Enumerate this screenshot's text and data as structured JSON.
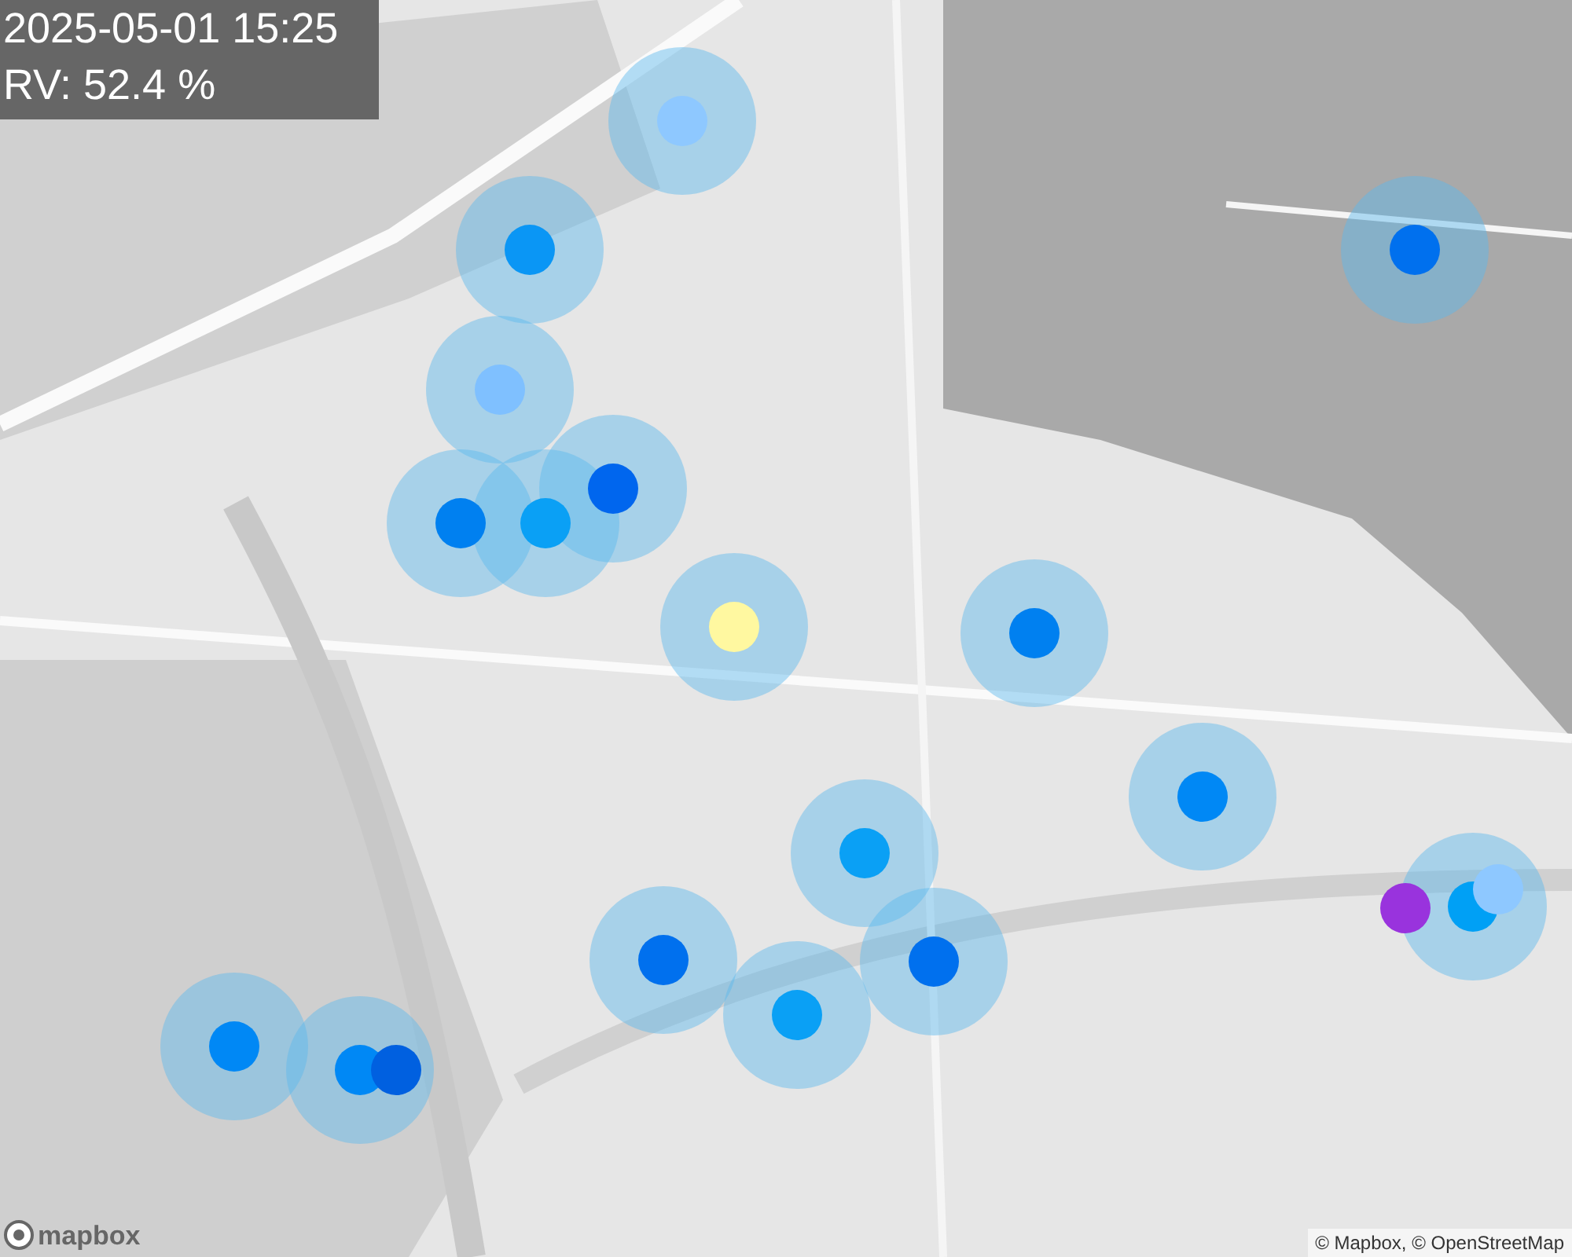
{
  "overlay": {
    "timestamp": "2025-05-01 15:25",
    "humidity": "RV: 52.4 %"
  },
  "markers": [
    {
      "color": "#8ec8ff"
    },
    {
      "color": "#0a96f5"
    },
    {
      "color": "#7fc0ff"
    },
    {
      "color": "#0066ee"
    },
    {
      "color": "#0080f0"
    },
    {
      "color": "#0aa0f5"
    },
    {
      "color": "#fff8a0"
    },
    {
      "color": "#0080f0"
    },
    {
      "color": "#0070ee"
    },
    {
      "color": "#0088f5"
    },
    {
      "color": "#0aa0f5"
    },
    {
      "color": "#0070ee"
    },
    {
      "color": "#0aa0f5"
    },
    {
      "color": "#0070ee"
    },
    {
      "color": "#0088f5"
    },
    {
      "color": "#0088f5"
    },
    {
      "color": "#0060e0"
    },
    {
      "color": "#9933dd"
    },
    {
      "color": "#00a0f5"
    },
    {
      "color": "#8ec8ff"
    }
  ],
  "logo": "mapbox",
  "attribution": "© Mapbox, © OpenStreetMap"
}
